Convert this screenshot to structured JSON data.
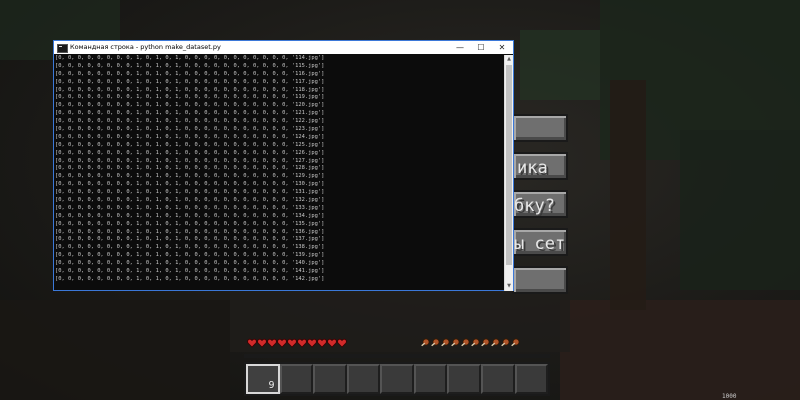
{
  "window": {
    "title": "Командная строка - python make_dataset.py",
    "controls": {
      "minimize": "—",
      "maximize": "☐",
      "close": "✕"
    }
  },
  "terminal": {
    "lines": [
      "[0, 0, 0, 0, 0, 0, 0, 0, 1, 0, 1, 0, 1, 0, 0, 0, 0, 0, 0, 0, 0, 0, 0, 0, '114.jpg']",
      "[0, 0, 0, 0, 0, 0, 0, 0, 1, 0, 1, 0, 1, 0, 0, 0, 0, 0, 0, 0, 0, 0, 0, 0, '115.jpg']",
      "[0, 0, 0, 0, 0, 0, 0, 0, 1, 0, 1, 0, 1, 0, 0, 0, 0, 0, 0, 0, 0, 0, 0, 0, '116.jpg']",
      "[0, 0, 0, 0, 0, 0, 0, 0, 1, 0, 1, 0, 1, 0, 0, 0, 0, 0, 0, 0, 0, 0, 0, 0, '117.jpg']",
      "[0, 0, 0, 0, 0, 0, 0, 0, 1, 0, 1, 0, 1, 0, 0, 0, 0, 0, 0, 0, 0, 0, 0, 0, '118.jpg']",
      "[0, 0, 0, 0, 0, 0, 0, 0, 1, 0, 1, 0, 1, 0, 0, 0, 0, 0, 0, 0, 0, 0, 0, 0, '119.jpg']",
      "[0, 0, 0, 0, 0, 0, 0, 0, 1, 0, 1, 0, 1, 0, 0, 0, 0, 0, 0, 0, 0, 0, 0, 0, '120.jpg']",
      "[0, 0, 0, 0, 0, 0, 0, 0, 1, 0, 1, 0, 1, 0, 0, 0, 0, 0, 0, 0, 0, 0, 0, 0, '121.jpg']",
      "[0, 0, 0, 0, 0, 0, 0, 0, 1, 0, 1, 0, 1, 0, 0, 0, 0, 0, 0, 0, 0, 0, 0, 0, '122.jpg']",
      "[0, 0, 0, 0, 0, 0, 0, 0, 1, 0, 1, 0, 1, 0, 0, 0, 0, 0, 0, 0, 0, 0, 0, 0, '123.jpg']",
      "[0, 0, 0, 0, 0, 0, 0, 0, 1, 0, 1, 0, 1, 0, 0, 0, 0, 0, 0, 0, 0, 0, 0, 0, '124.jpg']",
      "[0, 0, 0, 0, 0, 0, 0, 0, 1, 0, 1, 0, 1, 0, 0, 0, 0, 0, 0, 0, 0, 0, 0, 0, '125.jpg']",
      "[0, 0, 0, 0, 0, 0, 0, 0, 1, 0, 1, 0, 1, 0, 0, 0, 0, 0, 0, 0, 0, 0, 0, 0, '126.jpg']",
      "[0, 0, 0, 0, 0, 0, 0, 0, 1, 0, 1, 0, 1, 0, 0, 0, 0, 0, 0, 0, 0, 0, 0, 0, '127.jpg']",
      "[0, 0, 0, 0, 0, 0, 0, 0, 1, 0, 1, 0, 1, 0, 0, 0, 0, 0, 0, 0, 0, 0, 0, 0, '128.jpg']",
      "[0, 0, 0, 0, 0, 0, 0, 0, 1, 0, 1, 0, 1, 0, 0, 0, 0, 0, 0, 0, 0, 0, 0, 0, '129.jpg']",
      "[0, 0, 0, 0, 0, 0, 0, 0, 1, 0, 1, 0, 1, 0, 0, 0, 0, 0, 0, 0, 0, 0, 0, 0, '130.jpg']",
      "[0, 0, 0, 0, 0, 0, 0, 0, 1, 0, 1, 0, 1, 0, 0, 0, 0, 0, 0, 0, 0, 0, 0, 0, '131.jpg']",
      "[0, 0, 0, 0, 0, 0, 0, 0, 1, 0, 1, 0, 1, 0, 0, 0, 0, 0, 0, 0, 0, 0, 0, 0, '132.jpg']",
      "[0, 0, 0, 0, 0, 0, 0, 0, 1, 0, 1, 0, 1, 0, 0, 0, 0, 0, 0, 0, 0, 0, 0, 0, '133.jpg']",
      "[0, 0, 0, 0, 0, 0, 0, 0, 1, 0, 1, 0, 1, 0, 0, 0, 0, 0, 0, 0, 0, 0, 0, 0, '134.jpg']",
      "[0, 0, 0, 0, 0, 0, 0, 0, 1, 0, 1, 0, 1, 0, 0, 0, 0, 0, 0, 0, 0, 0, 0, 0, '135.jpg']",
      "[0, 0, 0, 0, 0, 0, 0, 0, 1, 0, 1, 0, 1, 0, 0, 0, 0, 0, 0, 0, 0, 0, 0, 0, '136.jpg']",
      "[0, 0, 0, 0, 0, 0, 0, 0, 1, 0, 1, 0, 1, 0, 0, 0, 0, 0, 0, 0, 0, 0, 0, 0, '137.jpg']",
      "[0, 0, 0, 0, 0, 0, 0, 0, 1, 0, 1, 0, 1, 0, 0, 0, 0, 0, 0, 0, 0, 0, 0, 0, '138.jpg']",
      "[0, 0, 0, 0, 0, 0, 0, 0, 1, 0, 1, 0, 1, 0, 0, 0, 0, 0, 0, 0, 0, 0, 0, 0, '139.jpg']",
      "[0, 0, 0, 0, 0, 0, 0, 0, 1, 0, 1, 0, 1, 0, 0, 0, 0, 0, 0, 0, 0, 0, 0, 0, '140.jpg']",
      "[0, 0, 0, 0, 0, 0, 0, 0, 1, 0, 1, 0, 1, 0, 0, 0, 0, 0, 0, 0, 0, 0, 0, 0, '141.jpg']",
      "[0, 0, 0, 0, 0, 0, 0, 0, 1, 0, 1, 0, 1, 0, 0, 0, 0, 0, 0, 0, 0, 0, 0, 0, '142.jpg']"
    ]
  },
  "pause_menu": {
    "buttons": [
      {
        "label": ""
      },
      {
        "label": "ика"
      },
      {
        "label": "бку?"
      },
      {
        "label": "ы сети"
      },
      {
        "label": ""
      }
    ]
  },
  "hud": {
    "health_hearts": 10,
    "food_level": 10,
    "hotbar_slots": 9,
    "selected_slot": 1,
    "selected_slot_count": "9"
  },
  "corner_text": "1000",
  "colors": {
    "console_bg": "#0c0c0c",
    "console_text": "#c8c8c8",
    "window_border": "#3b78d8",
    "button_face": "#6f6f6f",
    "heart": "#d22a2a",
    "food": "#b0552a"
  }
}
